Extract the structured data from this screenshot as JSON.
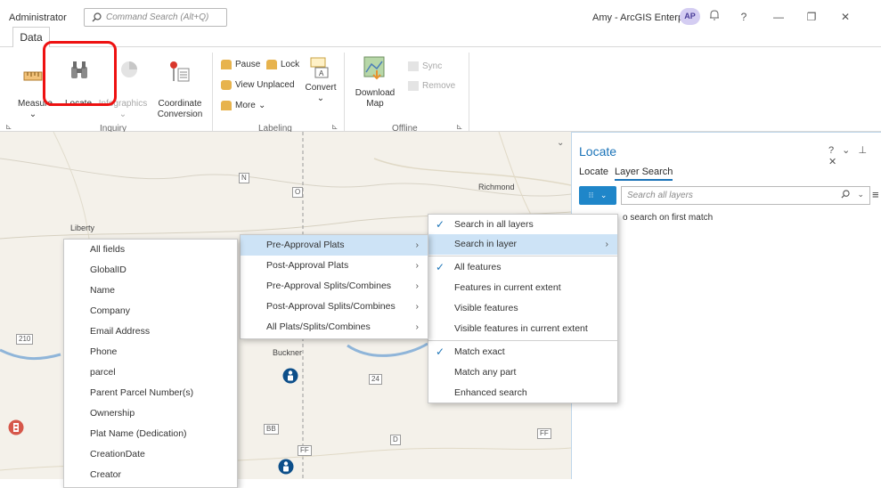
{
  "titlebar": {
    "user_role": "Administrator",
    "command_search_placeholder": "Command Search (Alt+Q)",
    "account": "Amy - ArcGIS Enterprise",
    "avatar_initials": "AP",
    "help_glyph": "?",
    "minimize_glyph": "—",
    "restore_glyph": "❐",
    "close_glyph": "✕"
  },
  "ribbon": {
    "active_tab": "Data",
    "inquiry": {
      "group_label": "Inquiry",
      "measure": "Measure",
      "locate": "Locate",
      "infographics": "Infographics",
      "coordinate_conversion_1": "Coordinate",
      "coordinate_conversion_2": "Conversion"
    },
    "labeling": {
      "group_label": "Labeling",
      "pause": "Pause",
      "lock": "Lock",
      "view_unplaced": "View Unplaced",
      "more": "More",
      "convert": "Convert"
    },
    "offline": {
      "group_label": "Offline",
      "download_map_1": "Download",
      "download_map_2": "Map",
      "sync": "Sync",
      "remove": "Remove"
    }
  },
  "map": {
    "labels": {
      "liberty": "Liberty",
      "richmond": "Richmond",
      "buckner": "Buckner"
    },
    "shields": [
      "N",
      "O",
      "24",
      "BB",
      "FF",
      "D",
      "FF",
      "210"
    ]
  },
  "locate_pane": {
    "title": "Locate",
    "header_controls": "? ⌄ ⊥ ✕",
    "tabs": [
      "Locate",
      "Layer Search"
    ],
    "active_tab": "Layer Search",
    "search_placeholder": "Search all layers",
    "stop_option_text": "o search on first match"
  },
  "fields_menu": {
    "items": [
      "All fields",
      "GlobalID",
      "Name",
      "Company",
      "Email Address",
      "Phone",
      "parcel",
      "Parent Parcel Number(s)",
      "Ownership",
      "Plat Name (Dedication)",
      "CreationDate",
      "Creator"
    ]
  },
  "layers_menu": {
    "items": [
      "Pre-Approval Plats",
      "Post-Approval Plats",
      "Pre-Approval Splits/Combines",
      "Post-Approval Splits/Combines",
      "All Plats/Splits/Combines"
    ],
    "highlighted": "Pre-Approval Plats"
  },
  "options_menu": {
    "scope": [
      {
        "label": "Search in all layers",
        "checked": true
      },
      {
        "label": "Search in layer",
        "checked": false,
        "submenu": true,
        "highlighted": true
      }
    ],
    "extent": [
      {
        "label": "All features",
        "checked": true
      },
      {
        "label": "Features in current extent",
        "checked": false
      },
      {
        "label": "Visible features",
        "checked": false
      },
      {
        "label": "Visible features in current extent",
        "checked": false
      }
    ],
    "match": [
      {
        "label": "Match exact",
        "checked": true
      },
      {
        "label": "Match any part",
        "checked": false
      },
      {
        "label": "Enhanced search",
        "checked": false
      }
    ]
  },
  "colors": {
    "accent": "#1a73b8",
    "menu_highlight": "#cde3f6",
    "annotation_red": "#e11111",
    "avatar_bg": "#d4cdf2"
  }
}
